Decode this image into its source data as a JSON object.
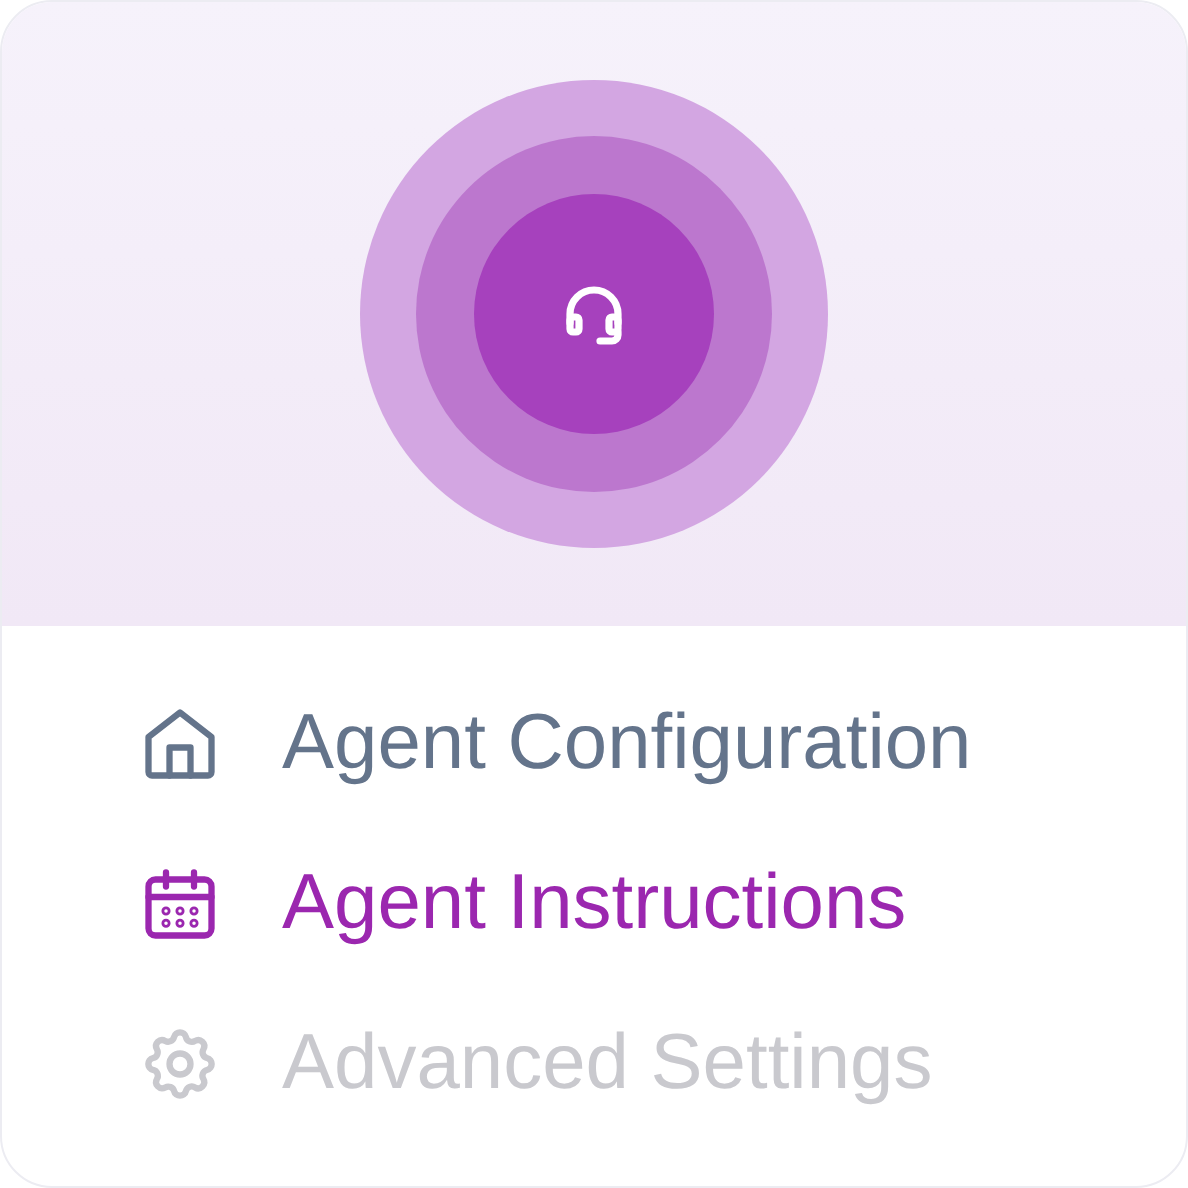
{
  "menu": {
    "items": [
      {
        "label": "Agent Configuration",
        "kind": "home",
        "selected": false,
        "disabled": false
      },
      {
        "label": "Agent Instructions",
        "kind": "calendar",
        "selected": true,
        "disabled": false
      },
      {
        "label": "Advanced Settings",
        "kind": "gear",
        "selected": false,
        "disabled": true
      }
    ]
  }
}
